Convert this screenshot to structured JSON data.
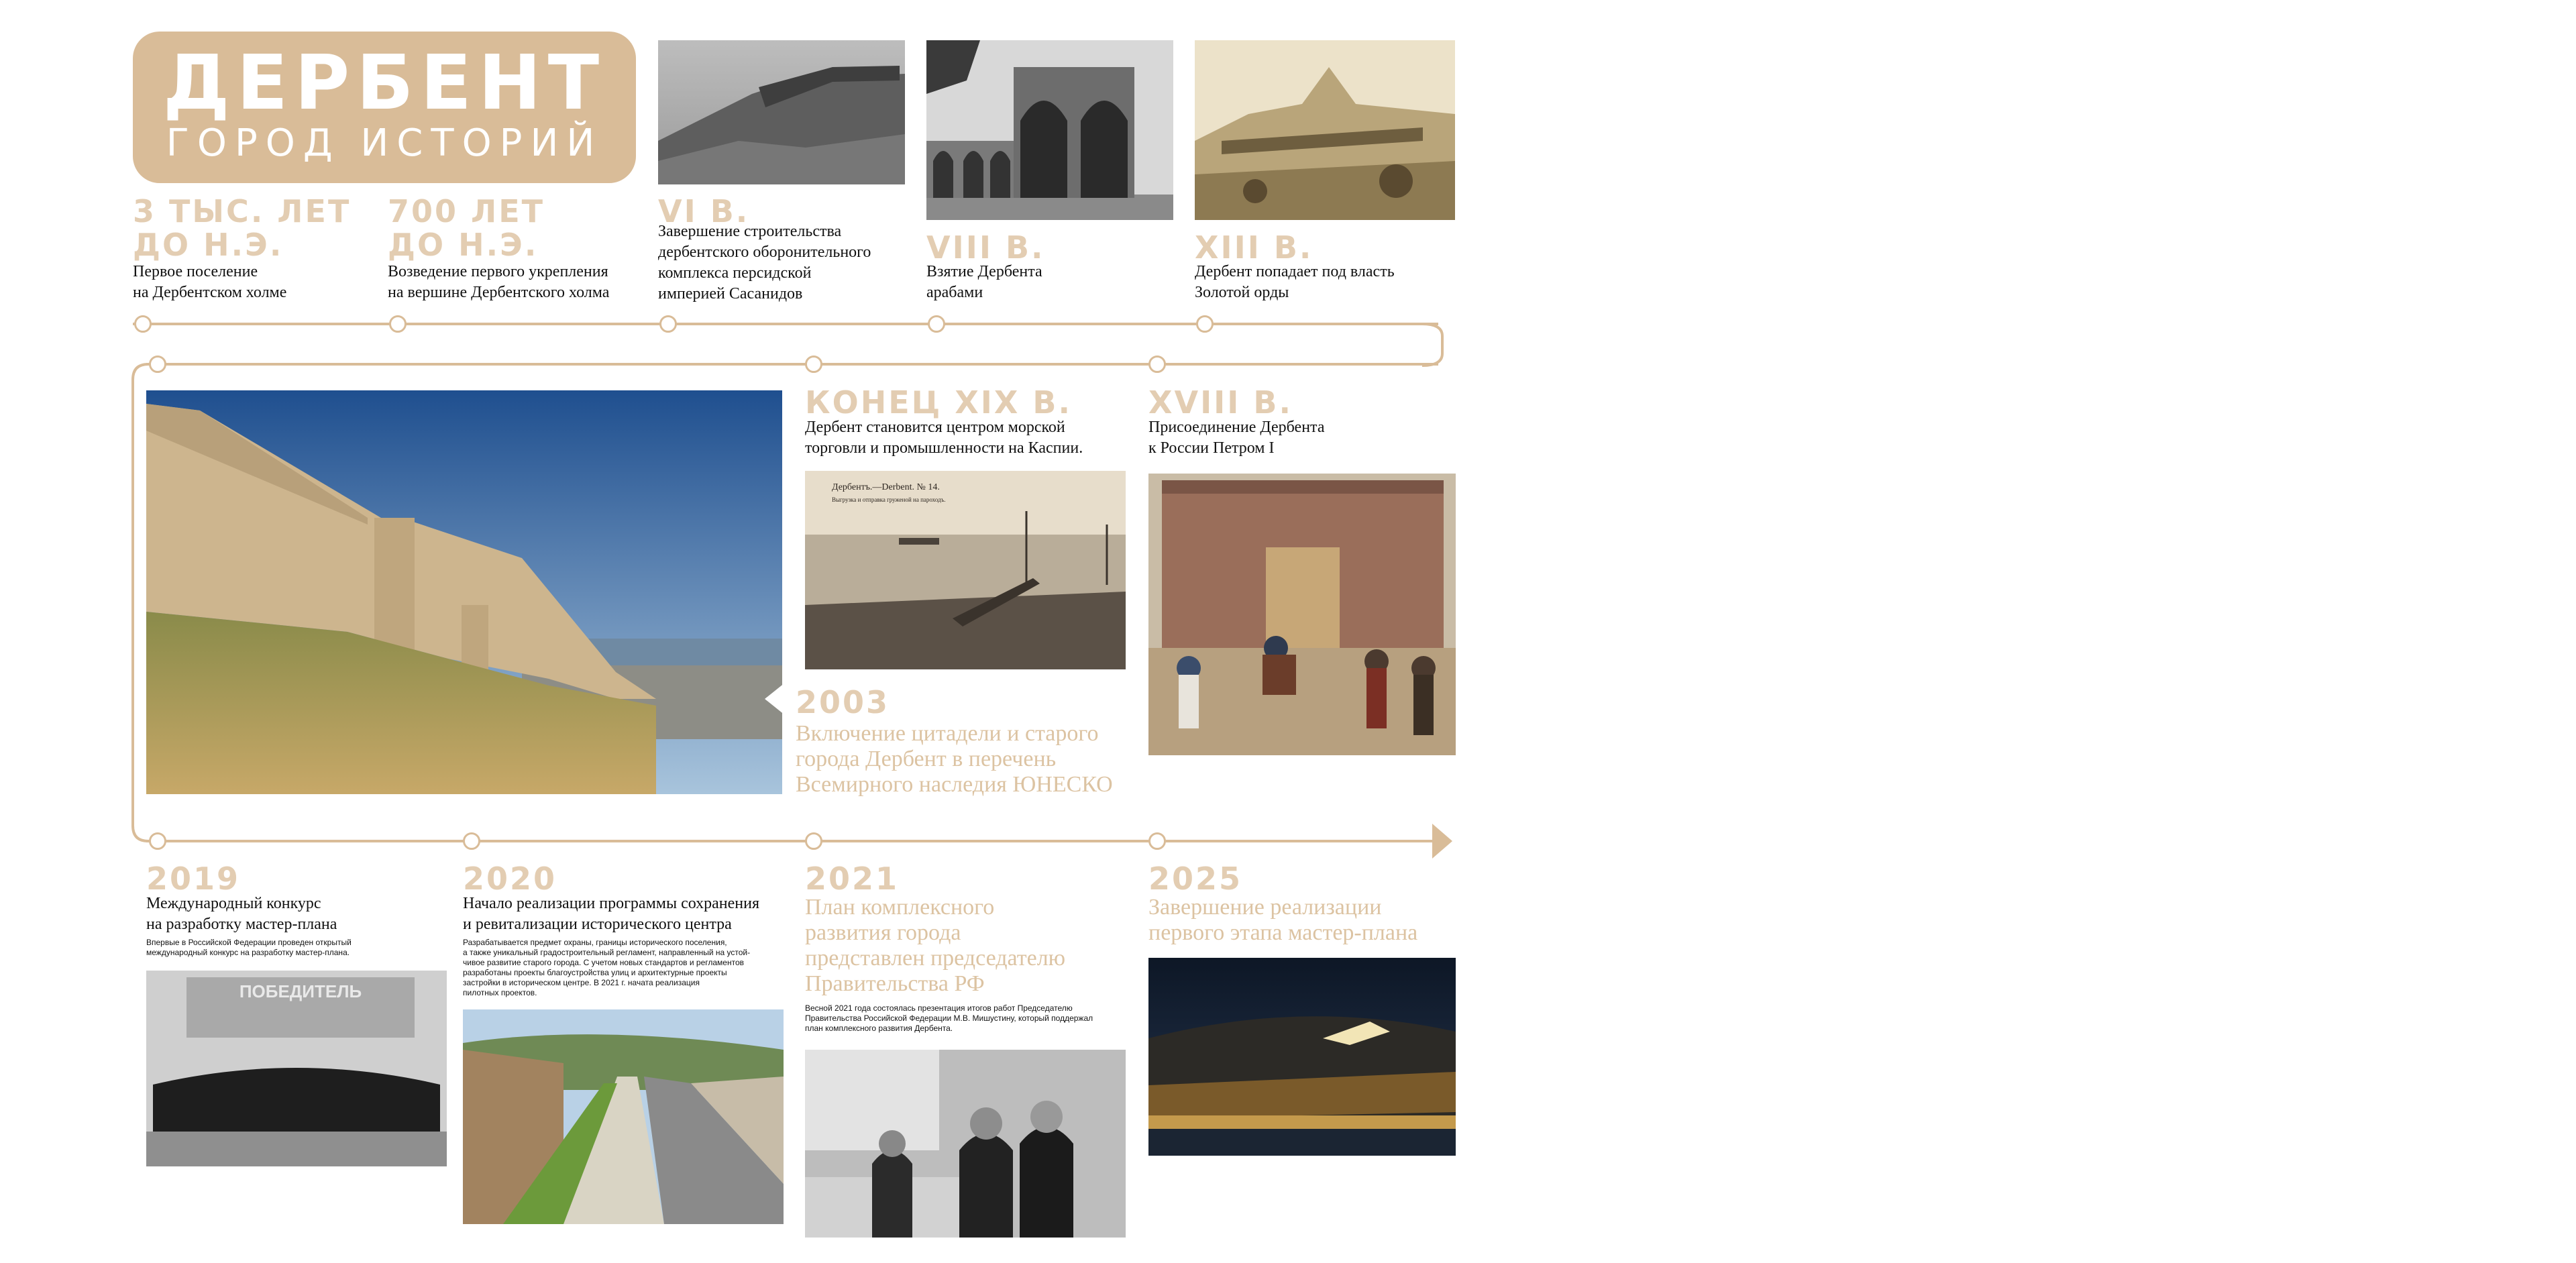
{
  "title": {
    "main": "ДЕРБЕНТ",
    "sub": "ГОРОД ИСТОРИЙ"
  },
  "top_row": [
    {
      "era": "3 ТЫС. ЛЕТ\nДО Н.Э.",
      "text": "Первое поселение\nна Дербентском холме"
    },
    {
      "era": "700 ЛЕТ\nДО Н.Э.",
      "text": "Возведение первого укрепления\nна вершине Дербентского холма"
    },
    {
      "era": "VI В.",
      "text": "Завершение строительства\nдербентского оборонительного\nкомплекса персидской\nимперией Сасанидов"
    },
    {
      "era": "VIII В.",
      "text": "Взятие Дербента\nарабами"
    },
    {
      "era": "XIII В.",
      "text": "Дербент попадает под власть\nЗолотой орды"
    }
  ],
  "middle_row": [
    {
      "era": "КОНЕЦ XIX В.",
      "text": "Дербент становится центром морской\nторговли и промышленности на Каспии."
    },
    {
      "era": "XVIII В.",
      "text": "Присоединение Дербента\nк России Петром I"
    }
  ],
  "unesco": {
    "era": "2003",
    "text": "Включение цитадели и старого\nгорода Дербент в перечень\nВсемирного наследия ЮНЕСКО"
  },
  "postcard": {
    "line1": "Дербентъ.—Derbent. № 14.",
    "line2": "Выгрузка и отправка груженой на пароходъ."
  },
  "bottom_row": [
    {
      "era": "2019",
      "text": "Международный конкурс\nна разработку мастер-плана",
      "note": "Впервые в Российской Федерации проведен открытый\nмеждународный конкурс на разработку мастер-плана."
    },
    {
      "era": "2020",
      "text": "Начало реализации программы сохранения\nи ревитализации исторического центра",
      "note": "Разрабатывается предмет охраны, границы исторического поселения,\nа также уникальный градостроительный регламент, направленный на устой-\nчивое развитие старого города. С учетом новых стандартов и регламентов\nразработаны проекты благоустройства улиц и архитектурные проекты\nзастройки в историческом центре. В 2021 г. начата реализация\nпилотных проектов."
    },
    {
      "era": "2021",
      "text": "План комплексного\nразвития города\nпредставлен председателю\nПравительства РФ",
      "note": "Весной 2021 года состоялась презентация итогов работ Председателю\nПравительства Российской Федерации М.В. Мишустину, который поддержал\nплан комплексного развития Дербента."
    },
    {
      "era": "2025",
      "text": "Завершение реализации\nпервого этапа мастер-плана"
    }
  ],
  "winner_banner": "ПОБЕДИТЕЛЬ",
  "colors": {
    "accent": "#d9bc98",
    "accent_light": "#e3cdb2",
    "text": "#111111"
  }
}
